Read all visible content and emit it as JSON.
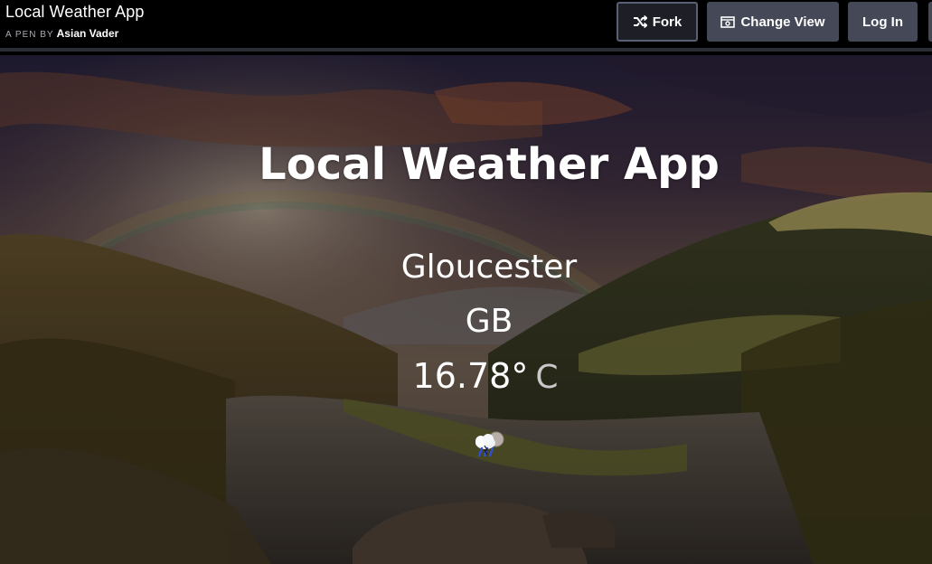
{
  "header": {
    "pen_title": "Local Weather App",
    "byline_prefix": "A PEN BY",
    "author": "Asian Vader",
    "buttons": {
      "fork": "Fork",
      "change_view": "Change View",
      "login": "Log In"
    }
  },
  "app": {
    "title": "Local Weather App",
    "city": "Gloucester",
    "country": "GB",
    "temperature": "16.78°",
    "unit": "C",
    "condition_icon": "cloud-rain-icon"
  },
  "colors": {
    "topbar_bg": "#000000",
    "button_bg": "#444857",
    "fork_border": "#5a5f73",
    "text": "#ffffff",
    "unit_text": "#c9c9c9"
  }
}
